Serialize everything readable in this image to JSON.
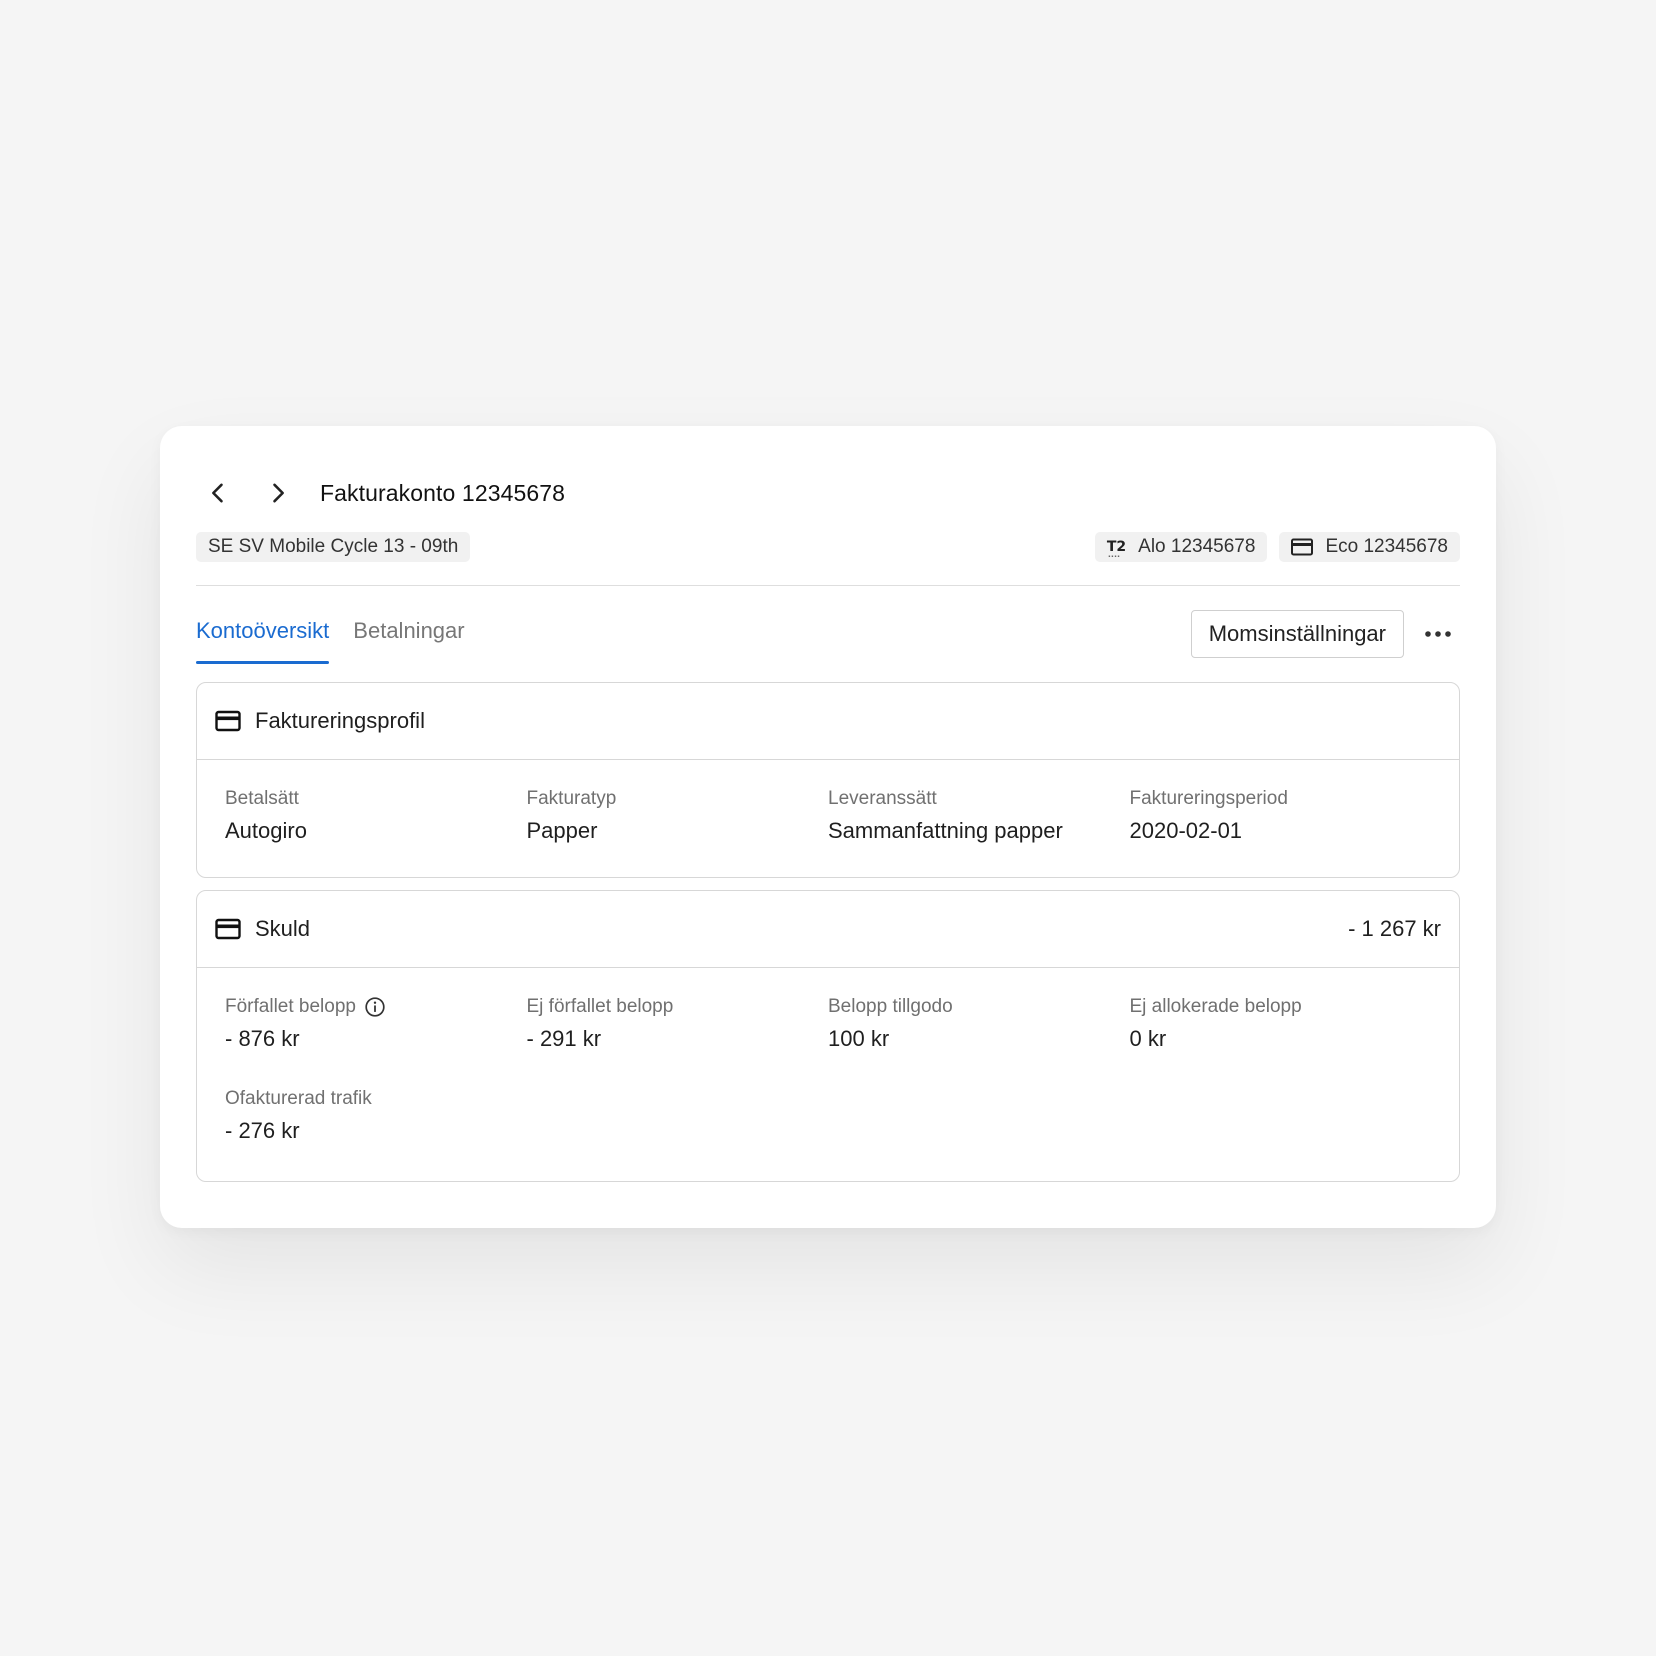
{
  "header": {
    "title": "Fakturakonto 12345678"
  },
  "chips": {
    "cycle": "SE SV Mobile Cycle 13 - 09th",
    "alo": "Alo 12345678",
    "eco": "Eco 12345678",
    "t2_mark": "T2"
  },
  "tabs": [
    {
      "label": "Kontoöversikt",
      "active": true
    },
    {
      "label": "Betalningar",
      "active": false
    }
  ],
  "actions": {
    "vat_button": "Momsinställningar"
  },
  "profile": {
    "title": "Faktureringsprofil",
    "fields": [
      {
        "label": "Betalsätt",
        "value": "Autogiro"
      },
      {
        "label": "Fakturatyp",
        "value": "Papper"
      },
      {
        "label": "Leveranssätt",
        "value": "Sammanfattning papper"
      },
      {
        "label": "Faktureringsperiod",
        "value": "2020-02-01"
      }
    ]
  },
  "debt": {
    "title": "Skuld",
    "total": "- 1 267 kr",
    "fields": [
      {
        "label": "Förfallet belopp",
        "value": "- 876 kr"
      },
      {
        "label": "Ej förfallet belopp",
        "value": "- 291 kr"
      },
      {
        "label": "Belopp tillgodo",
        "value": "100 kr"
      },
      {
        "label": "Ej allokerade belopp",
        "value": "0 kr"
      },
      {
        "label": "Ofakturerad trafik",
        "value": "- 276 kr"
      }
    ]
  },
  "colors": {
    "accent": "#1a6bd0",
    "background": "#f5f5f5",
    "card": "#ffffff",
    "border": "#d7d7d7",
    "muted_text": "#707070"
  },
  "icons": {
    "back": "chevron-left-icon",
    "forward": "chevron-right-icon",
    "card": "credit-card-icon",
    "info": "info-icon",
    "more": "more-horizontal-icon"
  }
}
